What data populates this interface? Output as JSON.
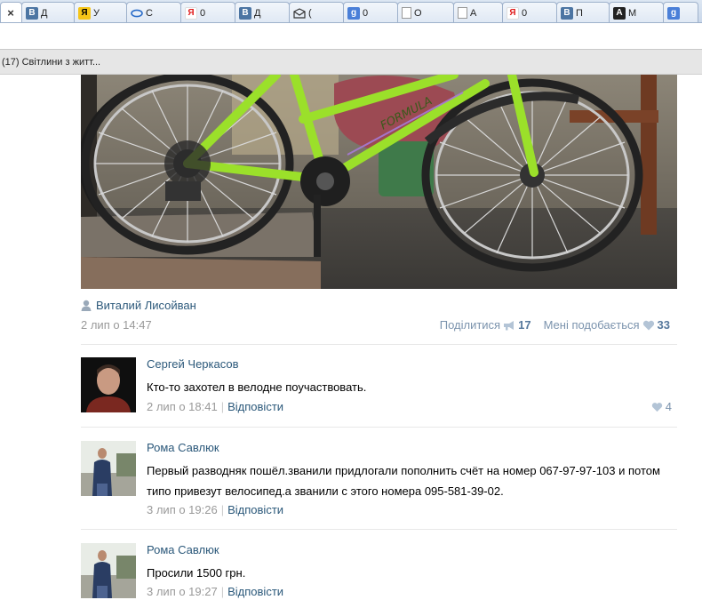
{
  "browser": {
    "tabs": [
      {
        "icon": "close-icon",
        "label": "×",
        "active": true
      },
      {
        "icon": "vk-icon",
        "label": "Д"
      },
      {
        "icon": "yandex-disk-icon",
        "label": "У"
      },
      {
        "icon": "eye-icon",
        "label": "С"
      },
      {
        "icon": "yandex-icon",
        "label": "0"
      },
      {
        "icon": "vk-icon",
        "label": "Д"
      },
      {
        "icon": "envelope-icon",
        "label": "("
      },
      {
        "icon": "google-icon",
        "label": "0"
      },
      {
        "icon": "document-icon",
        "label": "О"
      },
      {
        "icon": "document-icon",
        "label": "А"
      },
      {
        "icon": "yandex-icon",
        "label": "0"
      },
      {
        "icon": "vk-icon",
        "label": "П"
      },
      {
        "icon": "a-icon",
        "label": "М"
      },
      {
        "icon": "google-icon",
        "label": ""
      }
    ],
    "page_title": "(17) Світлини з житт..."
  },
  "post": {
    "author": "Виталий Лисойван",
    "date": "2 лип о 14:47",
    "share_label": "Поділитися",
    "share_count": "17",
    "like_label": "Мені подобається",
    "like_count": "33"
  },
  "comments": [
    {
      "name": "Сергей Черкасов",
      "text": "Кто-то захотел в велодне поучаствовать.",
      "date": "2 лип о 18:41",
      "reply": "Відповісти",
      "likes": "4"
    },
    {
      "name": "Рома Савлюк",
      "text": "Первый разводняк пошёл.званили придлогали пополнить счёт на номер 067-97-97-103 и потом типо привезут велосипед.а званили с этого номера 095-581-39-02.",
      "date": "3 лип о 19:26",
      "reply": "Відповісти"
    },
    {
      "name": "Рома Савлюк",
      "text": "Просили 1500 грн.",
      "date": "3 лип о 19:27",
      "reply": "Відповісти"
    }
  ],
  "colors": {
    "link": "#2b587a",
    "muted": "#999999",
    "bike_frame": "#9be02a"
  }
}
